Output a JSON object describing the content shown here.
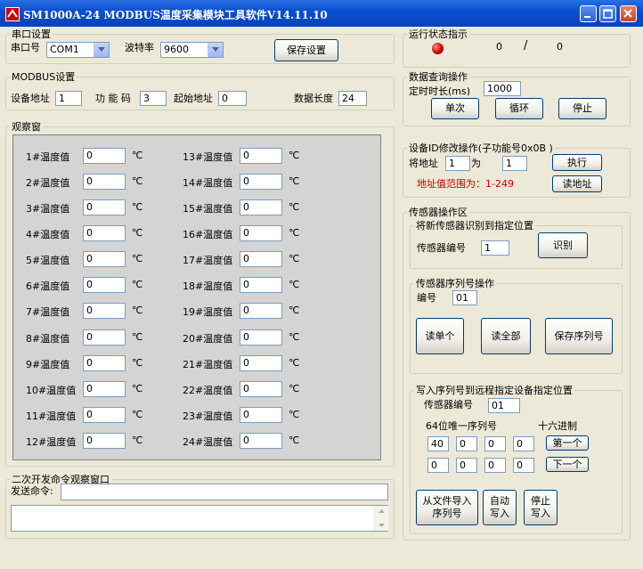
{
  "window": {
    "title": "SM1000A-24 MODBUS温度采集模块工具软件V14.11.10"
  },
  "serial": {
    "legend": "串口设置",
    "port_label": "串口号",
    "port_value": "COM1",
    "baud_label": "波特率",
    "baud_value": "9600",
    "save_button": "保存设置"
  },
  "modbus": {
    "legend": "MODBUS设置",
    "addr_label": "设备地址",
    "addr_value": "1",
    "func_label": "功 能 码",
    "func_value": "3",
    "start_label": "起始地址",
    "start_value": "0",
    "len_label": "数据长度",
    "len_value": "24"
  },
  "observe": {
    "legend": "观察窗",
    "unit": "℃",
    "left": [
      {
        "label": "1#温度值",
        "value": "0"
      },
      {
        "label": "2#温度值",
        "value": "0"
      },
      {
        "label": "3#温度值",
        "value": "0"
      },
      {
        "label": "4#温度值",
        "value": "0"
      },
      {
        "label": "5#温度值",
        "value": "0"
      },
      {
        "label": "6#温度值",
        "value": "0"
      },
      {
        "label": "7#温度值",
        "value": "0"
      },
      {
        "label": "8#温度值",
        "value": "0"
      },
      {
        "label": "9#温度值",
        "value": "0"
      },
      {
        "label": "10#温度值",
        "value": "0"
      },
      {
        "label": "11#温度值",
        "value": "0"
      },
      {
        "label": "12#温度值",
        "value": "0"
      }
    ],
    "right": [
      {
        "label": "13#温度值",
        "value": "0"
      },
      {
        "label": "14#温度值",
        "value": "0"
      },
      {
        "label": "15#温度值",
        "value": "0"
      },
      {
        "label": "16#温度值",
        "value": "0"
      },
      {
        "label": "17#温度值",
        "value": "0"
      },
      {
        "label": "18#温度值",
        "value": "0"
      },
      {
        "label": "19#温度值",
        "value": "0"
      },
      {
        "label": "20#温度值",
        "value": "0"
      },
      {
        "label": "21#温度值",
        "value": "0"
      },
      {
        "label": "22#温度值",
        "value": "0"
      },
      {
        "label": "23#温度值",
        "value": "0"
      },
      {
        "label": "24#温度值",
        "value": "0"
      }
    ]
  },
  "devcmd": {
    "legend": "二次开发命令观察窗口",
    "send_label": "发送命令:",
    "send_value": "",
    "output_value": ""
  },
  "status": {
    "legend": "运行状态指示",
    "led_color": "#d00000",
    "left_count": "0",
    "separator": "/",
    "right_count": "0"
  },
  "query": {
    "legend": "数据查询操作",
    "interval_label": "定时时长(ms)",
    "interval_value": "1000",
    "single_button": "单次",
    "loop_button": "循环",
    "stop_button": "停止"
  },
  "idmod": {
    "legend": "设备ID修改操作(子功能号0x0B )",
    "from_label": "将地址",
    "from_value": "1",
    "to_label": "为",
    "to_value": "1",
    "exec_button": "执行",
    "range_text": "地址值范围为：1-249",
    "read_button": "读地址"
  },
  "sensor": {
    "legend": "传感器操作区",
    "identify": {
      "legend": "将新传感器识别到指定位置",
      "num_label": "传感器编号",
      "num_value": "1",
      "identify_button": "识别"
    },
    "serialop": {
      "legend": "传感器序列号操作",
      "num_label": "编号",
      "num_value": "01",
      "read_one_button": "读单个",
      "read_all_button": "读全部",
      "save_button": "保存序列号"
    },
    "write": {
      "legend": "写入序列号到远程指定设备指定位置",
      "num_label": "传感器编号",
      "num_value": "01",
      "unique_label": "64位唯一序列号",
      "hex_label": "十六进制",
      "row1": [
        "40",
        "0",
        "0",
        "0"
      ],
      "row2": [
        "0",
        "0",
        "0",
        "0"
      ],
      "first_button": "第一个",
      "next_button": "下一个",
      "import_button": "从文件导入\n序列号",
      "auto_button": "自动\n写入",
      "stop_button": "停止\n写入"
    }
  }
}
